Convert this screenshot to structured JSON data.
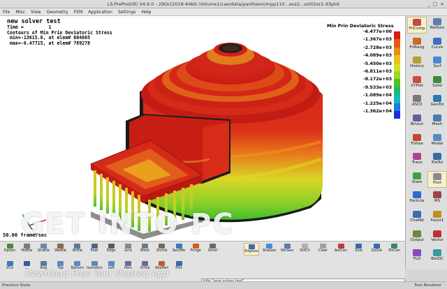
{
  "window": {
    "title": "LS-PrePost(R) V4.6.0 - 29Oct2018-64bit /Volume1/cae/data/pantheon/mpp110...avz2...sol02or2.d3plot",
    "controls": [
      "_",
      "□",
      "×"
    ]
  },
  "menu": [
    "File",
    "Misc",
    "View",
    "Geometry",
    "FEM",
    "Application",
    "Settings",
    "Help"
  ],
  "viewport": {
    "title": "new solver test",
    "time_line": "Time =         1",
    "contour_line": "Contours of Min Prin Deviatoric Stress",
    "min_line": " min=-13615.6, at elem# 604865",
    "max_line": " max=-6.47715, at elem# 789278",
    "frame_line": "50.00 frame/sec"
  },
  "legend": {
    "title": "Min Prin Deviatoric Stress",
    "entries": [
      {
        "label": "-6.477e+00",
        "color": "#d81c12"
      },
      {
        "label": "-1.367e+03",
        "color": "#e45a14"
      },
      {
        "label": "-2.728e+03",
        "color": "#e98c1a"
      },
      {
        "label": "-4.089e+03",
        "color": "#ecc01d"
      },
      {
        "label": "-5.450e+03",
        "color": "#d8de1e"
      },
      {
        "label": "-6.811e+03",
        "color": "#9ed624"
      },
      {
        "label": "-8.172e+03",
        "color": "#4cc12a"
      },
      {
        "label": "-9.533e+03",
        "color": "#1fb874"
      },
      {
        "label": "-1.089e+04",
        "color": "#17b8c0"
      },
      {
        "label": "-1.225e+04",
        "color": "#1a7ee0"
      },
      {
        "label": "-1.362e+04",
        "color": "#1d2fd6"
      }
    ]
  },
  "right_panel": [
    {
      "label": "FriComp",
      "icon": "fricomp-icon",
      "color": "#c44a3a",
      "selected": true
    },
    {
      "label": "RefGeo",
      "icon": "refgeo-icon",
      "color": "#5e7ca8"
    },
    {
      "label": "FriRang",
      "icon": "frirang-icon",
      "color": "#c86c2a"
    },
    {
      "label": "Curve",
      "icon": "curve-icon",
      "color": "#3a6fc4"
    },
    {
      "label": "History",
      "icon": "history-icon",
      "color": "#b0a030"
    },
    {
      "label": "Surf",
      "icon": "surf-icon",
      "color": "#4a88d0"
    },
    {
      "label": "XYPlot",
      "icon": "xyplot-icon",
      "color": "#d04a40"
    },
    {
      "label": "Solid",
      "icon": "solid-icon",
      "color": "#3a8a3a"
    },
    {
      "label": "ASCII",
      "icon": "ascii-icon",
      "color": "#7a7a7a"
    },
    {
      "label": "GeoTol",
      "icon": "geotol-icon",
      "color": "#2a7ab0"
    },
    {
      "label": "Binout",
      "icon": "binout-icon",
      "color": "#6060a0"
    },
    {
      "label": "Mesh",
      "icon": "mesh-icon",
      "color": "#4a7ab0"
    },
    {
      "label": "Follow",
      "icon": "follow-icon",
      "color": "#c04a2a"
    },
    {
      "label": "Model",
      "icon": "model-icon",
      "color": "#5a8ac0"
    },
    {
      "label": "Trace",
      "icon": "trace-icon",
      "color": "#b04090"
    },
    {
      "label": "EleTol",
      "icon": "eletol-icon",
      "color": "#3a6aa0"
    },
    {
      "label": "State",
      "icon": "state-icon",
      "color": "#40a040"
    },
    {
      "label": "Post",
      "icon": "post-icon",
      "color": "#8a8a8a",
      "selected": true
    },
    {
      "label": "Particle",
      "icon": "particle-icon",
      "color": "#2a6ad0"
    },
    {
      "label": "MS",
      "icon": "ms-icon",
      "color": "#a04040"
    },
    {
      "label": "ChaMd",
      "icon": "chamd-icon",
      "color": "#3a6ab0"
    },
    {
      "label": "Favor1",
      "icon": "favor-icon",
      "color": "#c09020"
    },
    {
      "label": "Output",
      "icon": "output-icon",
      "color": "#6a8a3a"
    },
    {
      "label": "Vector",
      "icon": "vector-icon",
      "color": "#c03030"
    },
    {
      "label": "FLD",
      "icon": "fld-icon",
      "color": "#8a4ac0"
    },
    {
      "label": "BetDC",
      "icon": "betdc-icon",
      "color": "#3a9a9a"
    }
  ],
  "bottom_row1": [
    {
      "label": "Option",
      "icon": "option-icon",
      "color": "#4a8a3a"
    },
    {
      "label": "HidEle",
      "icon": "hidele-icon",
      "color": "#7a7a7a"
    },
    {
      "label": "ShaEle",
      "icon": "shaele-icon",
      "color": "#6a8aaa"
    },
    {
      "label": "WelEle",
      "icon": "welele-icon",
      "color": "#8a6a4a"
    },
    {
      "label": "WrEle",
      "icon": "wrele-icon",
      "color": "#5a7a9a"
    },
    {
      "label": "Feat",
      "icon": "feat-icon",
      "color": "#4a6a8a"
    },
    {
      "label": "Edge",
      "icon": "edge-icon",
      "color": "#5a5a5a"
    },
    {
      "label": "Grid",
      "icon": "grid-icon",
      "color": "#7a8a9a"
    },
    {
      "label": "Mesh",
      "icon": "mesh-view-icon",
      "color": "#6a7a8a"
    },
    {
      "label": "Shrink",
      "icon": "shrink-icon",
      "color": "#7a6a5a"
    },
    {
      "label": "SectMe",
      "icon": "sectme-icon",
      "color": "#3a7aba"
    },
    {
      "label": "Fringe",
      "icon": "fringe-icon",
      "color": "#d05a20"
    },
    {
      "label": "Unref",
      "icon": "unref-icon",
      "color": "#6a6a6a"
    },
    {
      "label": "EdgGeo",
      "icon": "edggeo-icon",
      "color": "#3a6ac0",
      "selected": true
    },
    {
      "label": "ShaGeo",
      "icon": "shageo-icon",
      "color": "#4a8ad0"
    },
    {
      "label": "WirGeo",
      "icon": "wirgeo-icon",
      "color": "#5a7ab0"
    },
    {
      "label": "ShfClr",
      "icon": "shfclr-icon",
      "color": "#b0b0b0"
    },
    {
      "label": "Clear",
      "icon": "clear-icon",
      "color": "#a0a0a0"
    },
    {
      "label": "AutCen",
      "icon": "autcen-icon",
      "color": "#c03a3a"
    },
    {
      "label": "ZoIn",
      "icon": "zoom-in-icon",
      "color": "#3a6ab0"
    },
    {
      "label": "ZoOut",
      "icon": "zoom-out-icon",
      "color": "#3a6ab0"
    },
    {
      "label": "PicCen",
      "icon": "piccen-icon",
      "color": "#3a8a6a"
    }
  ],
  "bottom_row2": [
    {
      "label": "VCo",
      "icon": "vco-icon",
      "color": "#3a7ac0"
    },
    {
      "label": "...",
      "icon": "more-icon",
      "color": "#3a5aa0"
    },
    {
      "label": "Ang",
      "icon": "ang-icon",
      "color": "#5a7a9a"
    },
    {
      "label": "Top",
      "icon": "top-icon",
      "color": "#5a8ac0"
    },
    {
      "label": "Bottom",
      "icon": "bottom-icon",
      "color": "#5a8ac0"
    },
    {
      "label": "Isometric",
      "icon": "isometric-icon",
      "color": "#5a8ac0"
    },
    {
      "label": "Left",
      "icon": "left-icon",
      "color": "#5a8ac0"
    },
    {
      "label": "Pers",
      "icon": "pers-icon",
      "color": "#6a6a9a"
    },
    {
      "label": "Ortho",
      "icon": "ortho-icon",
      "color": "#6a6a9a"
    },
    {
      "label": "ResPart",
      "icon": "respart-icon",
      "color": "#c05a30"
    },
    {
      "label": "Plot",
      "icon": "plot-icon",
      "color": "#3a6ab0"
    }
  ],
  "command_line": "title \"new solver test\"",
  "status": {
    "left": "Previous State",
    "right": "Fast Renderer"
  },
  "watermark": {
    "main": "GET INTO PC",
    "sub": "Download Free Your Desired App"
  }
}
